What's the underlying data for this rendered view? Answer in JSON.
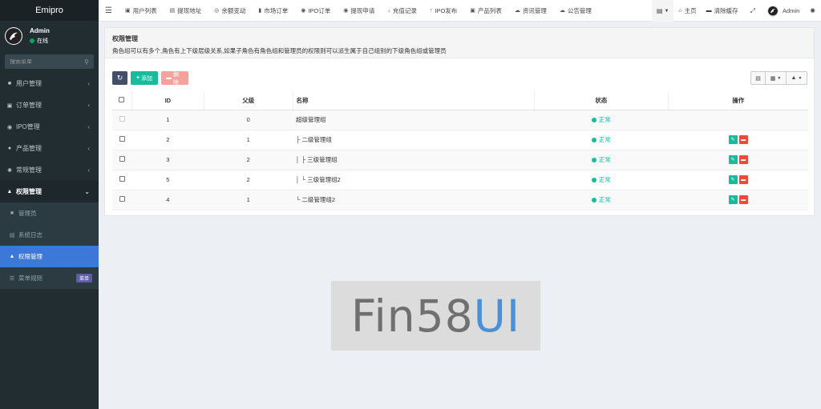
{
  "brand": "Emipro",
  "user": {
    "name": "Admin",
    "status": "在线"
  },
  "search": {
    "placeholder": "搜索菜单"
  },
  "sidebar": {
    "items": [
      {
        "label": "用户管理",
        "icon": "user-icon"
      },
      {
        "label": "订单管理",
        "icon": "cart-icon"
      },
      {
        "label": "IPO管理",
        "icon": "eye-icon"
      },
      {
        "label": "产品管理",
        "icon": "product-icon"
      },
      {
        "label": "常规管理",
        "icon": "gears-icon"
      },
      {
        "label": "权限管理",
        "icon": "group-icon"
      }
    ],
    "submenu": [
      {
        "label": "管理员",
        "icon": "user-icon"
      },
      {
        "label": "系统日志",
        "icon": "list-icon"
      },
      {
        "label": "权限管理",
        "icon": "group-icon"
      },
      {
        "label": "菜单规则",
        "icon": "bars-icon",
        "badge": "菜单"
      }
    ]
  },
  "topbar": {
    "tabs": [
      {
        "label": "用户列表",
        "icon": "user-list-icon"
      },
      {
        "label": "提现地址",
        "icon": "address-card-icon"
      },
      {
        "label": "余额变动",
        "icon": "balance-icon"
      },
      {
        "label": "市场订单",
        "icon": "bookmark-icon"
      },
      {
        "label": "IPO订单",
        "icon": "eye-icon"
      },
      {
        "label": "提现申请",
        "icon": "withdraw-icon"
      },
      {
        "label": "充值记录",
        "icon": "arrow-down-icon"
      },
      {
        "label": "IPO发布",
        "icon": "arrow-up-icon"
      },
      {
        "label": "产品列表",
        "icon": "product-icon"
      },
      {
        "label": "资讯管理",
        "icon": "cloud-icon"
      },
      {
        "label": "公告管理",
        "icon": "cloud-icon"
      }
    ],
    "home": "主页",
    "clear_cache": "清除缓存",
    "admin": "Admin"
  },
  "panel": {
    "title": "权限管理",
    "description": "角色组可以有多个,角色有上下级层级关系,如果子角色有角色组和管理员的权限则可以派生属于自己组别的下级角色组或管理员"
  },
  "toolbar": {
    "add": "添加",
    "delete": "删除"
  },
  "table": {
    "headers": {
      "id": "ID",
      "pid": "父级",
      "name": "名称",
      "status": "状态",
      "operate": "操作"
    },
    "rows": [
      {
        "id": "1",
        "pid": "0",
        "name": "超级管理组",
        "status": "正常"
      },
      {
        "id": "2",
        "pid": "1",
        "name": "├ 二级管理组",
        "status": "正常"
      },
      {
        "id": "3",
        "pid": "2",
        "name": "│ ├ 三级管理组",
        "status": "正常"
      },
      {
        "id": "5",
        "pid": "2",
        "name": "│ └ 三级管理组2",
        "status": "正常"
      },
      {
        "id": "4",
        "pid": "1",
        "name": "└ 二级管理组2",
        "status": "正常"
      }
    ]
  },
  "watermark": {
    "text_grey": "Fin58",
    "text_blue": "UI"
  },
  "colors": {
    "accent": "#18bc9c",
    "sidebar": "#222d32",
    "active": "#3c78d8",
    "danger": "#e74c3c"
  }
}
